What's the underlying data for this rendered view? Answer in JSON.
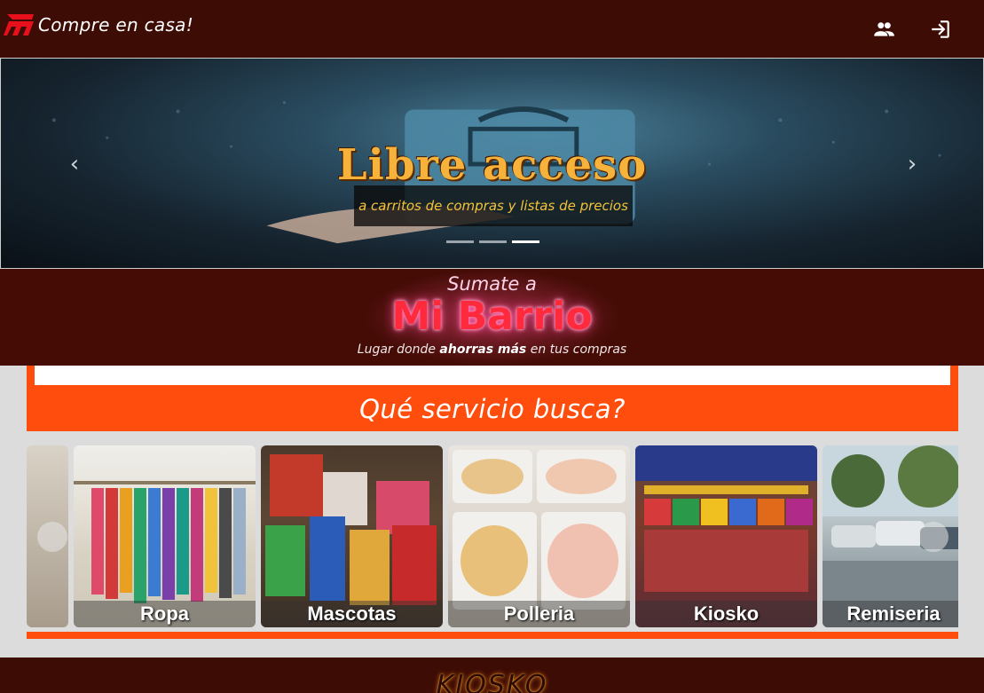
{
  "topbar": {
    "brand_text": "Compre en casa!",
    "icons": [
      "users-icon",
      "login-icon"
    ],
    "background": "#3d0c05"
  },
  "carousel": {
    "title": "Libre acceso",
    "subtitle": "a carritos de compras y listas de precios",
    "slides_count": 3,
    "active_slide": 3,
    "prev_label": "‹",
    "next_label": "›"
  },
  "band": {
    "sumate": "Sumate a",
    "barrio": "Mi Barrio",
    "tagline_before": "Lugar donde ",
    "tagline_bold": "ahorras más",
    "tagline_after": " en tus compras"
  },
  "service_heading": "Qué servicio busca?",
  "services": [
    {
      "label": "Ropa"
    },
    {
      "label": "Mascotas"
    },
    {
      "label": "Polleria"
    },
    {
      "label": "Kiosko"
    },
    {
      "label": "Remiseria"
    }
  ],
  "bottom": {
    "title": "KIOSKO"
  },
  "colors": {
    "accent": "#ff4d0d",
    "dark": "#3d0c05",
    "neon": "#ff2a3c"
  }
}
